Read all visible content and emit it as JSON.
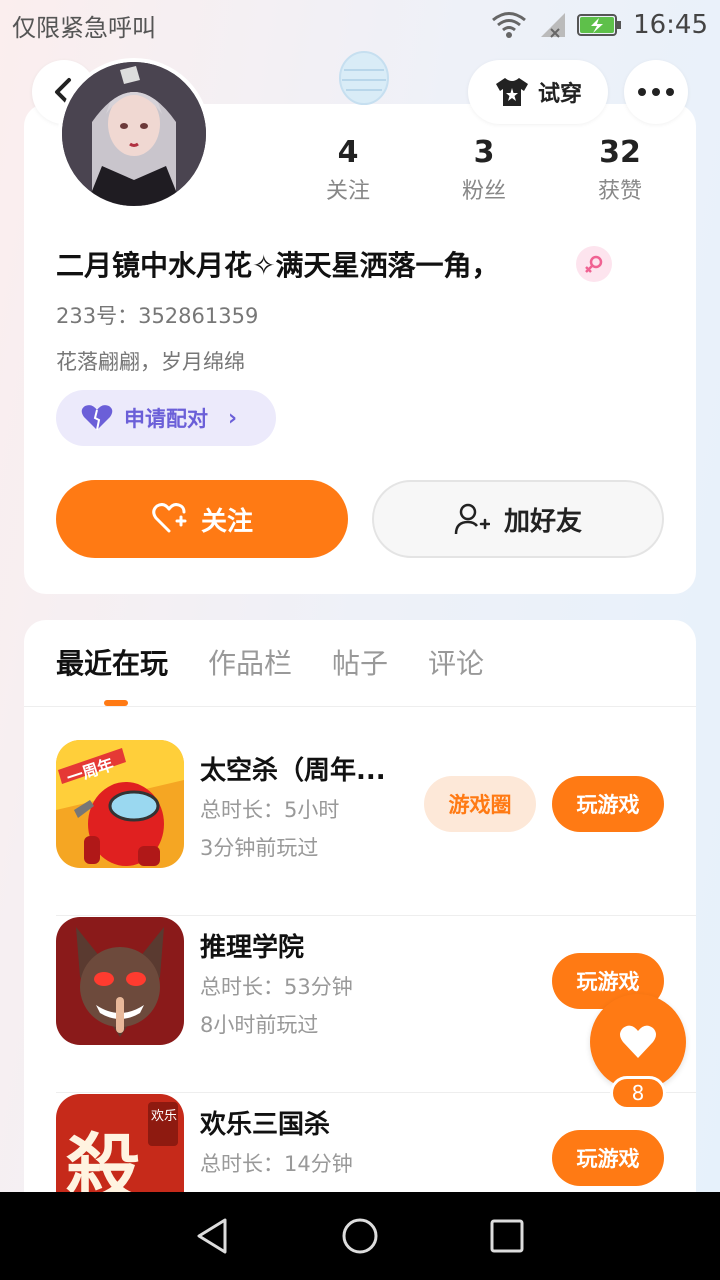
{
  "status_bar": {
    "carrier_text": "仅限紧急呼叫",
    "time": "16:45",
    "icons": [
      "wifi-icon",
      "signal-icon",
      "battery-charging-icon"
    ]
  },
  "header": {
    "tryon_label": "试穿"
  },
  "profile": {
    "stats": [
      {
        "value": "4",
        "label": "关注"
      },
      {
        "value": "3",
        "label": "粉丝"
      },
      {
        "value": "32",
        "label": "获赞"
      }
    ],
    "username": "二月镜中水月花✧满天星洒落一角，",
    "uid": "233号：352861359",
    "bio": "花落翩翩，岁月绵绵",
    "pair_label": "申请配对",
    "follow_label": "关注",
    "add_friend_label": "加好友"
  },
  "tabs": [
    "最近在玩",
    "作品栏",
    "帖子",
    "评论"
  ],
  "games": [
    {
      "name": "太空杀（周年...",
      "duration": "总时长：5小时",
      "last_played": "3分钟前玩过",
      "circle_label": "游戏圈",
      "play_label": "玩游戏",
      "icon_badge": "一周年"
    },
    {
      "name": "推理学院",
      "duration": "总时长：53分钟",
      "last_played": "8小时前玩过",
      "play_label": "玩游戏"
    },
    {
      "name": "欢乐三国杀",
      "duration": "总时长：14分钟",
      "last_played": "",
      "play_label": "玩游戏",
      "icon_char": "殺",
      "icon_badge": "欢乐"
    }
  ],
  "fab": {
    "count": "8"
  },
  "colors": {
    "accent": "#ff7a14",
    "pair": "#6b5fd8",
    "pair_bg": "#eceafb"
  }
}
